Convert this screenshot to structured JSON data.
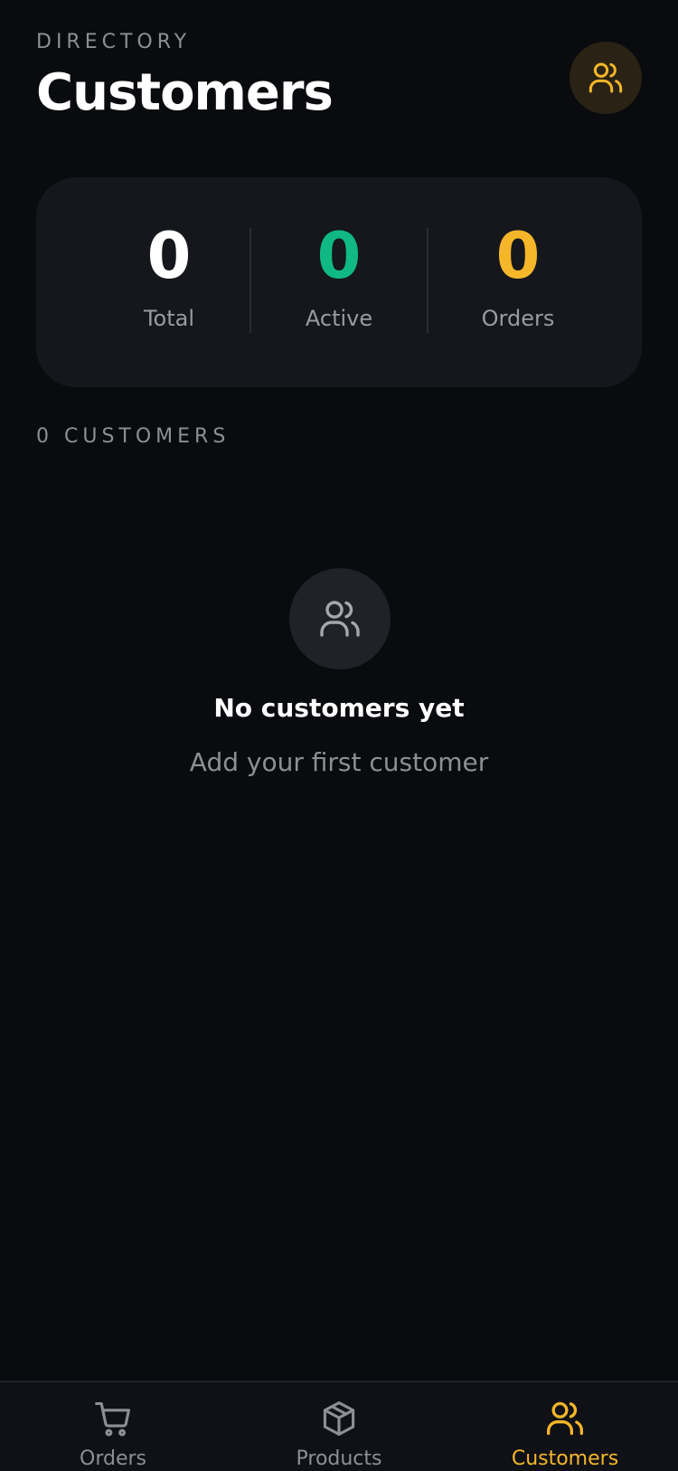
{
  "header": {
    "eyebrow": "DIRECTORY",
    "title": "Customers",
    "action_icon": "users-icon"
  },
  "stats": [
    {
      "value": "0",
      "label": "Total",
      "color": "#ffffff"
    },
    {
      "value": "0",
      "label": "Active",
      "color": "#10b981"
    },
    {
      "value": "0",
      "label": "Orders",
      "color": "#f5b62a"
    }
  ],
  "list": {
    "count_label": "0 CUSTOMERS"
  },
  "empty_state": {
    "icon": "users-icon",
    "title": "No customers yet",
    "subtitle": "Add your first customer"
  },
  "tabbar": {
    "tabs": [
      {
        "label": "Orders",
        "icon": "cart-icon",
        "active": false
      },
      {
        "label": "Products",
        "icon": "box-icon",
        "active": false
      },
      {
        "label": "Customers",
        "icon": "users-icon",
        "active": true
      }
    ]
  },
  "colors": {
    "accent": "#f5b62a",
    "success": "#10b981",
    "background": "#0a0b0e",
    "card": "#15171c"
  }
}
